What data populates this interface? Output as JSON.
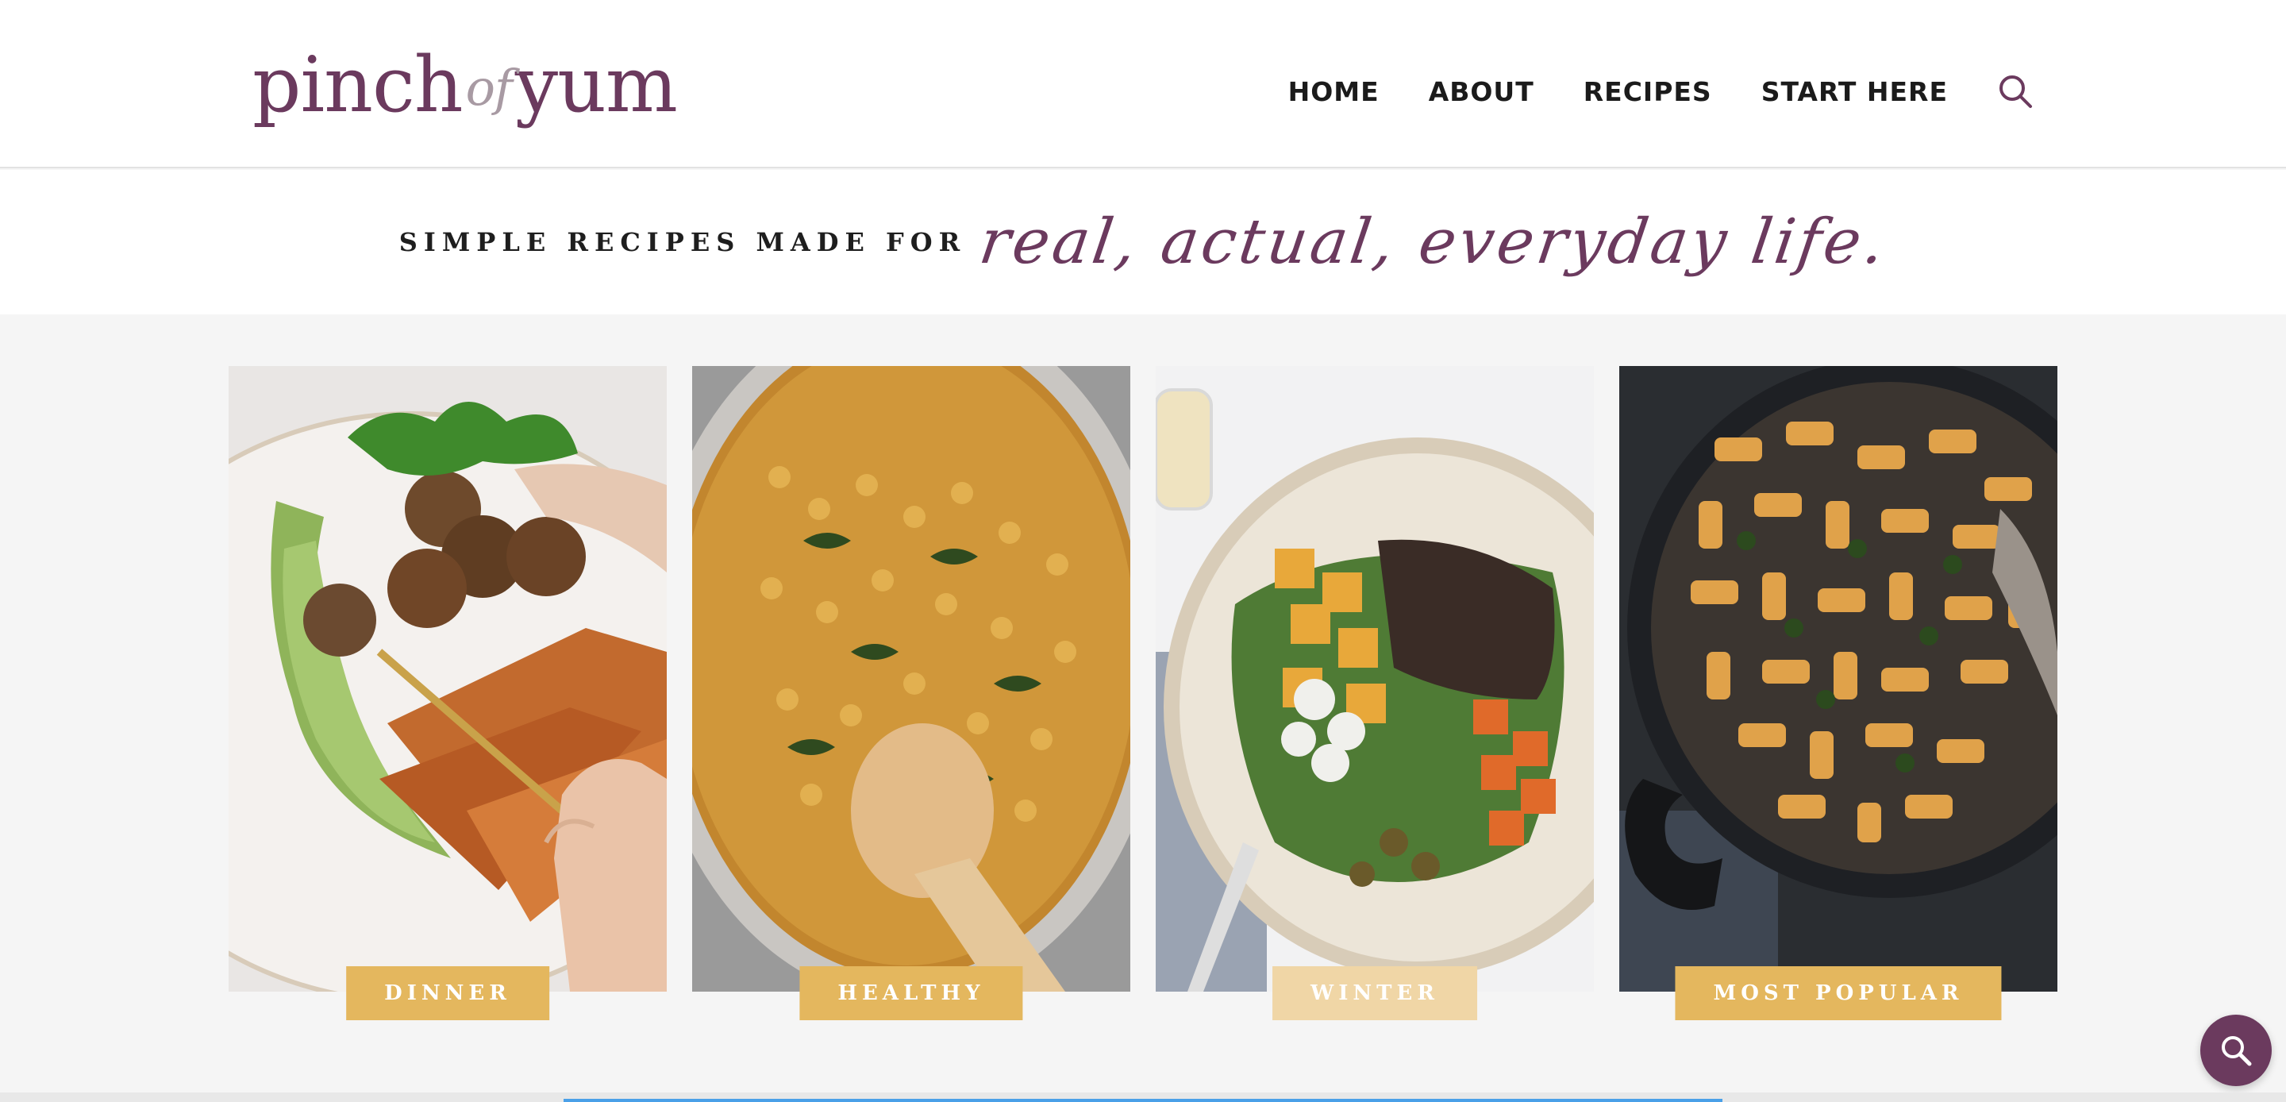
{
  "brand": {
    "logo_left": "pinch",
    "logo_of": "of",
    "logo_right": "yum",
    "color": "#6b3a5e"
  },
  "nav": {
    "items": [
      {
        "label": "HOME"
      },
      {
        "label": "ABOUT"
      },
      {
        "label": "RECIPES"
      },
      {
        "label": "START HERE"
      }
    ],
    "search_icon": "search-icon"
  },
  "tagline": {
    "caps": "SIMPLE RECIPES MADE FOR",
    "script": "real, actual, everyday life."
  },
  "categories": [
    {
      "label": "DINNER",
      "image": "meatballs-sweet-potato-plate"
    },
    {
      "label": "HEALTHY",
      "image": "chickpea-curry-pan"
    },
    {
      "label": "WINTER",
      "image": "squash-wild-rice-salad"
    },
    {
      "label": "MOST POPULAR",
      "image": "rigatoni-skillet"
    }
  ],
  "colors": {
    "accent": "#e4b75e",
    "accent_pale": "#f0d6a6",
    "brand": "#6b3a5e",
    "background": "#f5f5f5"
  },
  "fab": {
    "icon": "search-icon"
  }
}
